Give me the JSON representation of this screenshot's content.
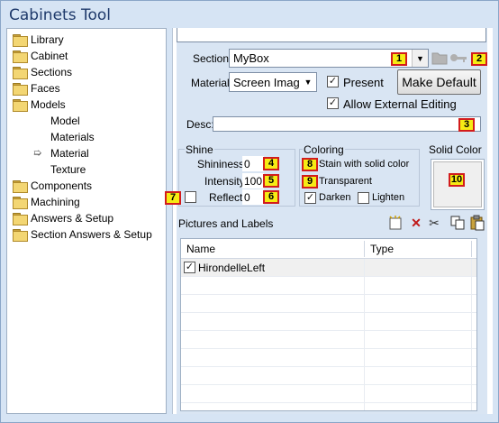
{
  "window": {
    "title": "Cabinets Tool"
  },
  "tree": {
    "items": [
      {
        "label": "Library",
        "icon": "folder-icon",
        "indent": 0
      },
      {
        "label": "Cabinet",
        "icon": "folder-icon",
        "indent": 0
      },
      {
        "label": "Sections",
        "icon": "folder-icon",
        "indent": 0
      },
      {
        "label": "Faces",
        "icon": "folder-icon",
        "indent": 0
      },
      {
        "label": "Models",
        "icon": "folder-icon",
        "indent": 0
      },
      {
        "label": "Model",
        "icon": "",
        "indent": 1
      },
      {
        "label": "Materials",
        "icon": "",
        "indent": 1
      },
      {
        "label": "Material",
        "icon": "arrow-icon",
        "indent": 1,
        "selected": true
      },
      {
        "label": "Texture",
        "icon": "",
        "indent": 1
      },
      {
        "label": "Components",
        "icon": "folder-icon",
        "indent": 0
      },
      {
        "label": "Machining",
        "icon": "folder-icon",
        "indent": 0
      },
      {
        "label": "Answers & Setup",
        "icon": "folder-icon",
        "indent": 0
      },
      {
        "label": "Section Answers & Setup",
        "icon": "folder-icon",
        "indent": 0
      }
    ]
  },
  "section": {
    "label": "Section:",
    "value": "MyBox"
  },
  "material": {
    "label": "Material",
    "value": "Screen Imag",
    "present_label": "Present",
    "present_checked": true,
    "allow_label": "Allow External Editing",
    "allow_checked": true,
    "make_default_label": "Make Default"
  },
  "desc": {
    "label": "Desc:",
    "value": ""
  },
  "shine": {
    "title": "Shine",
    "shininess_label": "Shininess:",
    "shininess_value": "0",
    "intensity_label": "Intensity:",
    "intensity_value": "100",
    "reflect_label": "Reflect:",
    "reflect_value": "0"
  },
  "coloring": {
    "title": "Coloring",
    "stain_label": "Stain with solid color",
    "transparent_label": "Transparent",
    "darken_label": "Darken",
    "darken_checked": true,
    "lighten_label": "Lighten",
    "lighten_checked": false
  },
  "solid_color": {
    "title": "Solid Color"
  },
  "badges": [
    "1",
    "2",
    "3",
    "4",
    "5",
    "6",
    "7",
    "8",
    "9",
    "10"
  ],
  "pictures": {
    "title": "Pictures and Labels",
    "columns": [
      "Name",
      "Type"
    ],
    "rows": [
      {
        "name": "HirondelleLeft",
        "type": "",
        "checked": true
      }
    ]
  },
  "colors": {
    "badge_fill": "#f6eb14",
    "badge_border": "#d21c1c",
    "panel": "#d9e5f3",
    "title": "#1f3a6b"
  }
}
